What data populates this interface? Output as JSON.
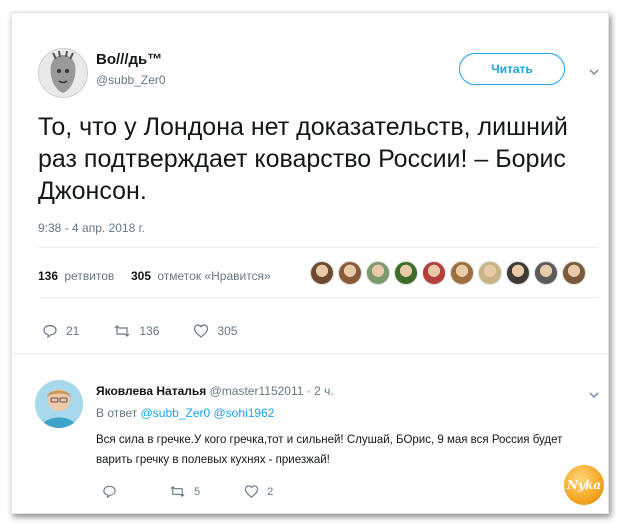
{
  "tweet": {
    "author_name": "Во///дь™",
    "author_handle": "@subb_Zer0",
    "follow_label": "Читать",
    "text": "То, что у Лондона нет доказательств, лишний раз подтверждает коварство России! – Борис Джонсон.",
    "timestamp": "9:38 - 4 апр. 2018 г.",
    "retweets_count": "136",
    "retweets_label": "ретвитов",
    "likes_count": "305",
    "likes_label": "отметок «Нравится»",
    "actions": {
      "replies": "21",
      "retweets": "136",
      "likes": "305"
    },
    "liker_colors": [
      "#6b4a2e",
      "#8a5b3a",
      "#7c9a6d",
      "#3d6b2a",
      "#b0423b",
      "#9c6f3f",
      "#c9b48a",
      "#3f3a34",
      "#5b5b5b",
      "#7a5a3b"
    ]
  },
  "reply": {
    "author_name": "Яковлева Наталья",
    "author_handle": "@master1152011",
    "time": "· 2 ч.",
    "in_reply_prefix": "В ответ",
    "in_reply_users": "@subb_Zer0 @sohi1962",
    "text": "Вся сила в гречке.У кого гречка,тот и сильней! Слушай, БОрис, 9 мая вся Россия будет варить гречку в полевых кухнях - приезжай!",
    "actions": {
      "replies": "",
      "retweets": "5",
      "likes": "2"
    }
  },
  "watermark": "Nyka",
  "colors": {
    "accent": "#1da1f2",
    "muted": "#657786",
    "text": "#14171a"
  }
}
